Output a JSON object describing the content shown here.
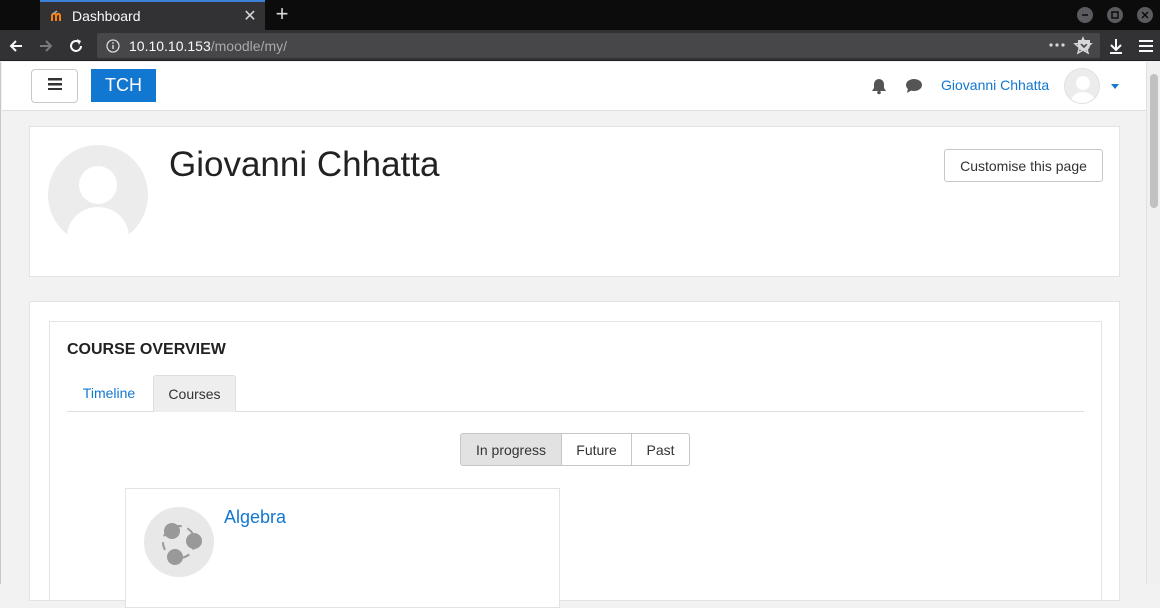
{
  "browser": {
    "tab_title": "Dashboard",
    "url_host": "10.10.10.153",
    "url_path": "/moodle/my/"
  },
  "header": {
    "brand": "TCH",
    "user_name": "Giovanni Chhatta"
  },
  "profile": {
    "name": "Giovanni Chhatta",
    "customise_label": "Customise this page"
  },
  "course_overview": {
    "title": "COURSE OVERVIEW",
    "tabs": [
      {
        "label": "Timeline"
      },
      {
        "label": "Courses"
      }
    ],
    "filters": [
      {
        "label": "In progress"
      },
      {
        "label": "Future"
      },
      {
        "label": "Past"
      }
    ],
    "courses": [
      {
        "name": "Algebra"
      }
    ]
  },
  "colors": {
    "accent": "#1177d1",
    "tab_indicator": "#3b7fd6"
  }
}
